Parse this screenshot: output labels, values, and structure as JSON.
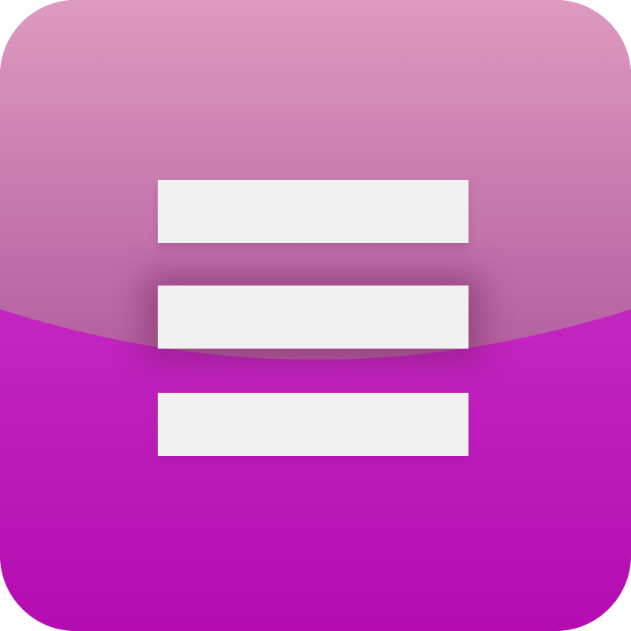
{
  "icon": {
    "name": "hamburger-menu-icon",
    "colors": {
      "gloss_top": "#de9abf",
      "gloss_bottom": "#b45fa0",
      "base_top": "#d040d2",
      "base_bottom": "#b40cb0",
      "bar": "#f1f1f1"
    },
    "bar_count": 3
  }
}
